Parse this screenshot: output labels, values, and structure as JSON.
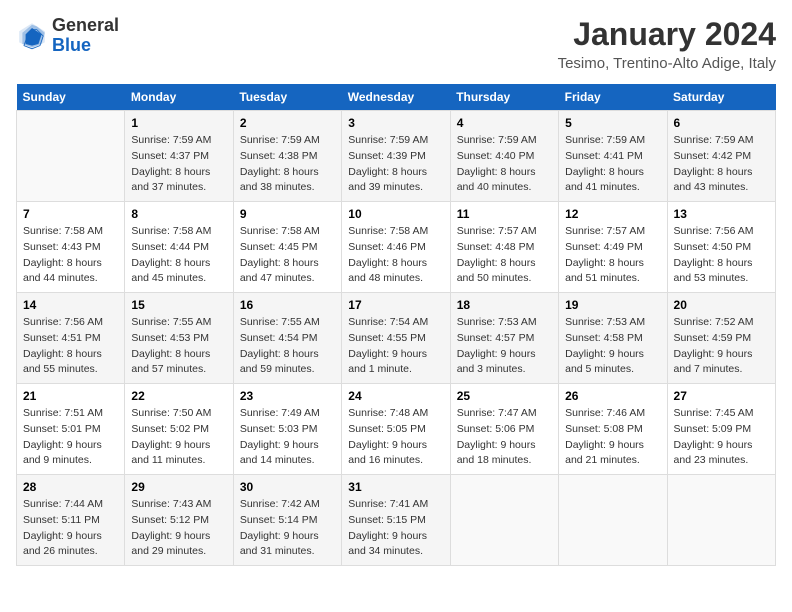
{
  "header": {
    "logo_general": "General",
    "logo_blue": "Blue",
    "month_year": "January 2024",
    "location": "Tesimo, Trentino-Alto Adige, Italy"
  },
  "columns": [
    "Sunday",
    "Monday",
    "Tuesday",
    "Wednesday",
    "Thursday",
    "Friday",
    "Saturday"
  ],
  "weeks": [
    [
      {
        "day": "",
        "info": ""
      },
      {
        "day": "1",
        "info": "Sunrise: 7:59 AM\nSunset: 4:37 PM\nDaylight: 8 hours and 37 minutes."
      },
      {
        "day": "2",
        "info": "Sunrise: 7:59 AM\nSunset: 4:38 PM\nDaylight: 8 hours and 38 minutes."
      },
      {
        "day": "3",
        "info": "Sunrise: 7:59 AM\nSunset: 4:39 PM\nDaylight: 8 hours and 39 minutes."
      },
      {
        "day": "4",
        "info": "Sunrise: 7:59 AM\nSunset: 4:40 PM\nDaylight: 8 hours and 40 minutes."
      },
      {
        "day": "5",
        "info": "Sunrise: 7:59 AM\nSunset: 4:41 PM\nDaylight: 8 hours and 41 minutes."
      },
      {
        "day": "6",
        "info": "Sunrise: 7:59 AM\nSunset: 4:42 PM\nDaylight: 8 hours and 43 minutes."
      }
    ],
    [
      {
        "day": "7",
        "info": "Sunrise: 7:58 AM\nSunset: 4:43 PM\nDaylight: 8 hours and 44 minutes."
      },
      {
        "day": "8",
        "info": "Sunrise: 7:58 AM\nSunset: 4:44 PM\nDaylight: 8 hours and 45 minutes."
      },
      {
        "day": "9",
        "info": "Sunrise: 7:58 AM\nSunset: 4:45 PM\nDaylight: 8 hours and 47 minutes."
      },
      {
        "day": "10",
        "info": "Sunrise: 7:58 AM\nSunset: 4:46 PM\nDaylight: 8 hours and 48 minutes."
      },
      {
        "day": "11",
        "info": "Sunrise: 7:57 AM\nSunset: 4:48 PM\nDaylight: 8 hours and 50 minutes."
      },
      {
        "day": "12",
        "info": "Sunrise: 7:57 AM\nSunset: 4:49 PM\nDaylight: 8 hours and 51 minutes."
      },
      {
        "day": "13",
        "info": "Sunrise: 7:56 AM\nSunset: 4:50 PM\nDaylight: 8 hours and 53 minutes."
      }
    ],
    [
      {
        "day": "14",
        "info": "Sunrise: 7:56 AM\nSunset: 4:51 PM\nDaylight: 8 hours and 55 minutes."
      },
      {
        "day": "15",
        "info": "Sunrise: 7:55 AM\nSunset: 4:53 PM\nDaylight: 8 hours and 57 minutes."
      },
      {
        "day": "16",
        "info": "Sunrise: 7:55 AM\nSunset: 4:54 PM\nDaylight: 8 hours and 59 minutes."
      },
      {
        "day": "17",
        "info": "Sunrise: 7:54 AM\nSunset: 4:55 PM\nDaylight: 9 hours and 1 minute."
      },
      {
        "day": "18",
        "info": "Sunrise: 7:53 AM\nSunset: 4:57 PM\nDaylight: 9 hours and 3 minutes."
      },
      {
        "day": "19",
        "info": "Sunrise: 7:53 AM\nSunset: 4:58 PM\nDaylight: 9 hours and 5 minutes."
      },
      {
        "day": "20",
        "info": "Sunrise: 7:52 AM\nSunset: 4:59 PM\nDaylight: 9 hours and 7 minutes."
      }
    ],
    [
      {
        "day": "21",
        "info": "Sunrise: 7:51 AM\nSunset: 5:01 PM\nDaylight: 9 hours and 9 minutes."
      },
      {
        "day": "22",
        "info": "Sunrise: 7:50 AM\nSunset: 5:02 PM\nDaylight: 9 hours and 11 minutes."
      },
      {
        "day": "23",
        "info": "Sunrise: 7:49 AM\nSunset: 5:03 PM\nDaylight: 9 hours and 14 minutes."
      },
      {
        "day": "24",
        "info": "Sunrise: 7:48 AM\nSunset: 5:05 PM\nDaylight: 9 hours and 16 minutes."
      },
      {
        "day": "25",
        "info": "Sunrise: 7:47 AM\nSunset: 5:06 PM\nDaylight: 9 hours and 18 minutes."
      },
      {
        "day": "26",
        "info": "Sunrise: 7:46 AM\nSunset: 5:08 PM\nDaylight: 9 hours and 21 minutes."
      },
      {
        "day": "27",
        "info": "Sunrise: 7:45 AM\nSunset: 5:09 PM\nDaylight: 9 hours and 23 minutes."
      }
    ],
    [
      {
        "day": "28",
        "info": "Sunrise: 7:44 AM\nSunset: 5:11 PM\nDaylight: 9 hours and 26 minutes."
      },
      {
        "day": "29",
        "info": "Sunrise: 7:43 AM\nSunset: 5:12 PM\nDaylight: 9 hours and 29 minutes."
      },
      {
        "day": "30",
        "info": "Sunrise: 7:42 AM\nSunset: 5:14 PM\nDaylight: 9 hours and 31 minutes."
      },
      {
        "day": "31",
        "info": "Sunrise: 7:41 AM\nSunset: 5:15 PM\nDaylight: 9 hours and 34 minutes."
      },
      {
        "day": "",
        "info": ""
      },
      {
        "day": "",
        "info": ""
      },
      {
        "day": "",
        "info": ""
      }
    ]
  ]
}
